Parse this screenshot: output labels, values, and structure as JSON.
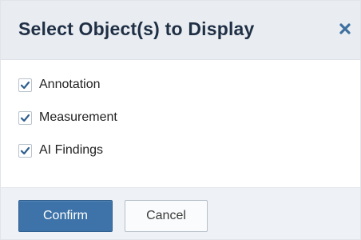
{
  "dialog": {
    "title": "Select Object(s) to Display",
    "close_icon": "close-icon",
    "options": [
      {
        "label": "Annotation",
        "checked": true
      },
      {
        "label": "Measurement",
        "checked": true
      },
      {
        "label": "AI Findings",
        "checked": true
      }
    ],
    "confirm_label": "Confirm",
    "cancel_label": "Cancel"
  },
  "colors": {
    "header_bg": "#e9edf2",
    "title_text": "#1f2f44",
    "close_icon": "#3e6f9f",
    "checkmark": "#2f5f8e",
    "confirm_bg": "#3d73a8",
    "cancel_bg": "#fafbfc",
    "footer_bg": "#eef1f5"
  }
}
